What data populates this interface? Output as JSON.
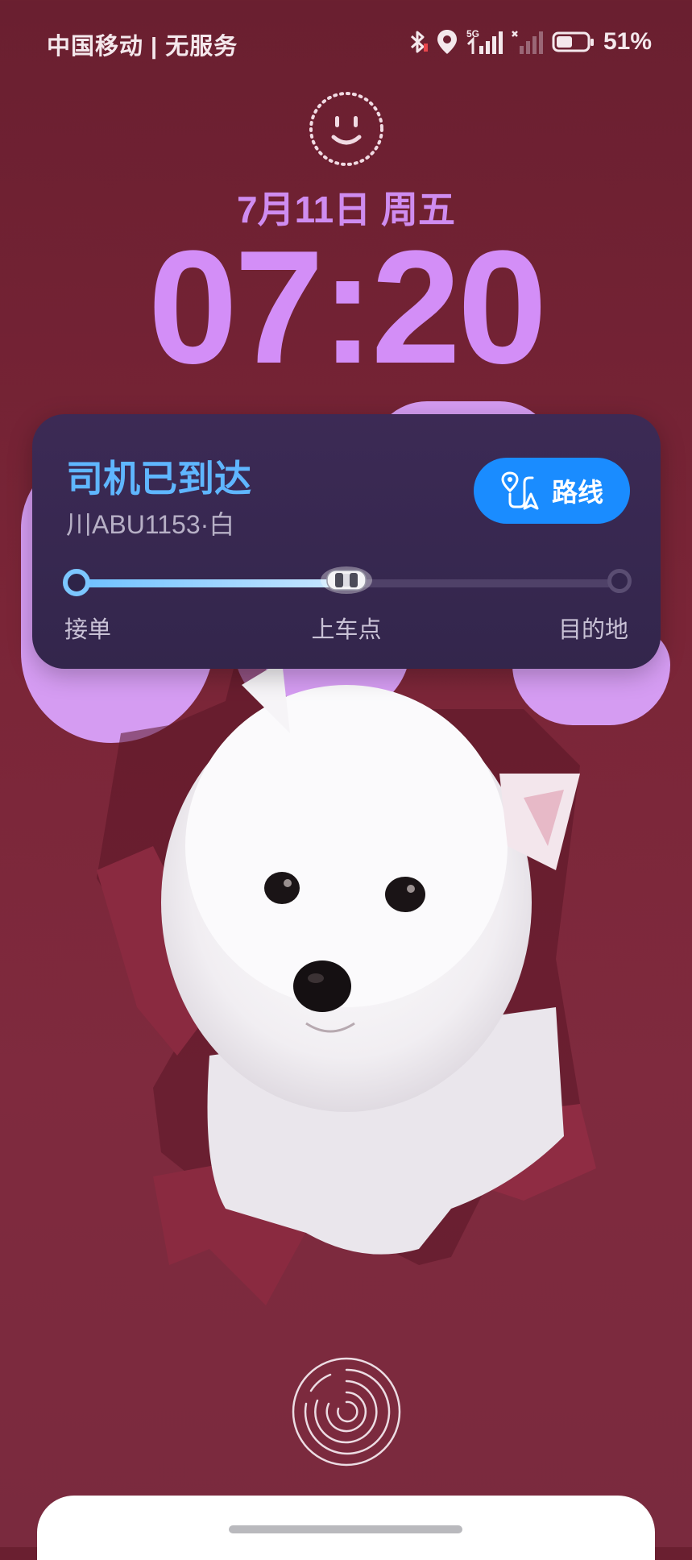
{
  "status_bar": {
    "carrier": "中国移动 | 无服务",
    "network": "5G",
    "battery_percent": "51%",
    "battery_level": 0.51,
    "icons": [
      "bluetooth-icon",
      "location-icon",
      "signal-5g-icon",
      "no-signal-icon",
      "battery-icon"
    ]
  },
  "lockscreen": {
    "date": "7月11日 周五",
    "time": "07:20",
    "face_icon": "smiley-face-icon"
  },
  "ride_card": {
    "status": "司机已到达",
    "plate": "川ABU1153·白",
    "route_button_label": "路线",
    "route_icon": "route-icon",
    "progress_fraction": 0.5,
    "stops": [
      "接单",
      "上车点",
      "目的地"
    ]
  },
  "colors": {
    "background": "#7a2537",
    "accent_purple": "#d38ef7",
    "card_bg": "#33264c",
    "status_blue": "#5fb6ff",
    "button_blue": "#1a8cff"
  },
  "bottom": {
    "fingerprint_icon": "fingerprint-icon"
  }
}
